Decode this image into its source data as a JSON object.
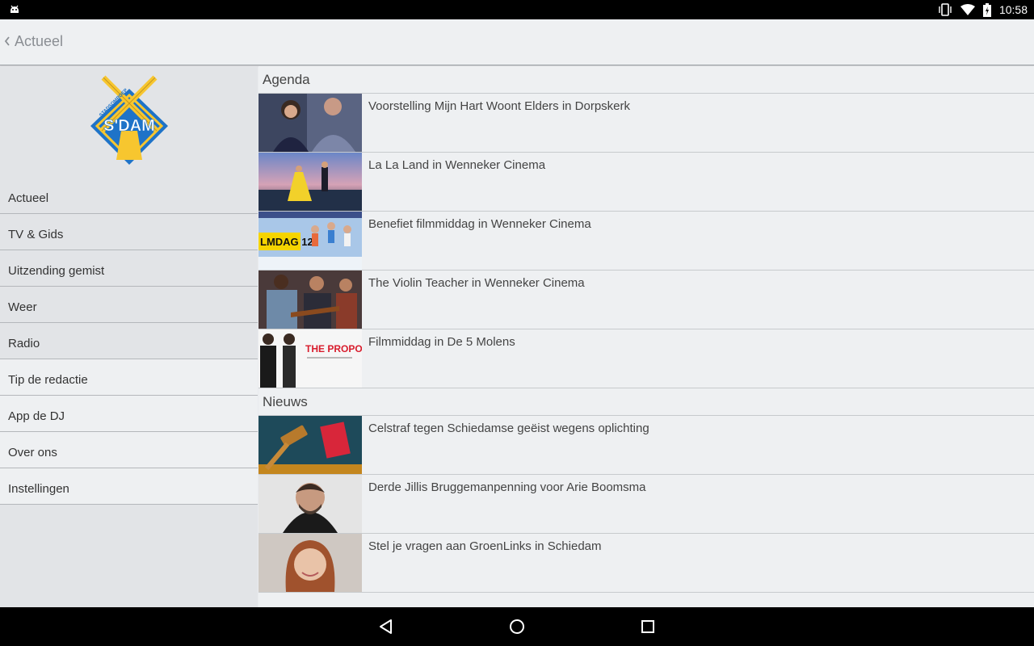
{
  "status_bar": {
    "time": "10:58"
  },
  "action_bar": {
    "title": "Actueel"
  },
  "sidebar": {
    "logo": {
      "top_text": "STADSOMROEP",
      "main_text": "S'DAM"
    },
    "items": [
      {
        "label": "Actueel"
      },
      {
        "label": "TV & Gids"
      },
      {
        "label": "Uitzending gemist"
      },
      {
        "label": "Weer"
      },
      {
        "label": "Radio"
      },
      {
        "label": "Tip de redactie"
      },
      {
        "label": "App de DJ"
      },
      {
        "label": "Over ons"
      },
      {
        "label": "Instellingen"
      }
    ]
  },
  "agenda": {
    "title": "Agenda",
    "items": [
      {
        "title": "Voorstelling Mijn Hart Woont Elders in Dorpskerk"
      },
      {
        "title": "La La Land in Wenneker Cinema"
      },
      {
        "title": "Benefiet filmmiddag in Wenneker Cinema",
        "thumb_text": "LMDAG 12"
      },
      {
        "title": "The Violin Teacher in Wenneker Cinema"
      },
      {
        "title": "Filmmiddag in De 5 Molens",
        "thumb_text": "THE PROPOSAL"
      }
    ]
  },
  "nieuws": {
    "title": "Nieuws",
    "items": [
      {
        "title": "Celstraf tegen Schiedamse geëist wegens oplichting"
      },
      {
        "title": "Derde Jillis Bruggemanpenning voor Arie Boomsma"
      },
      {
        "title": "Stel je vragen aan GroenLinks in Schiedam"
      }
    ]
  },
  "colors": {
    "brand_blue": "#1e73c8",
    "brand_yellow": "#f7c62f",
    "background": "#eef0f2"
  }
}
